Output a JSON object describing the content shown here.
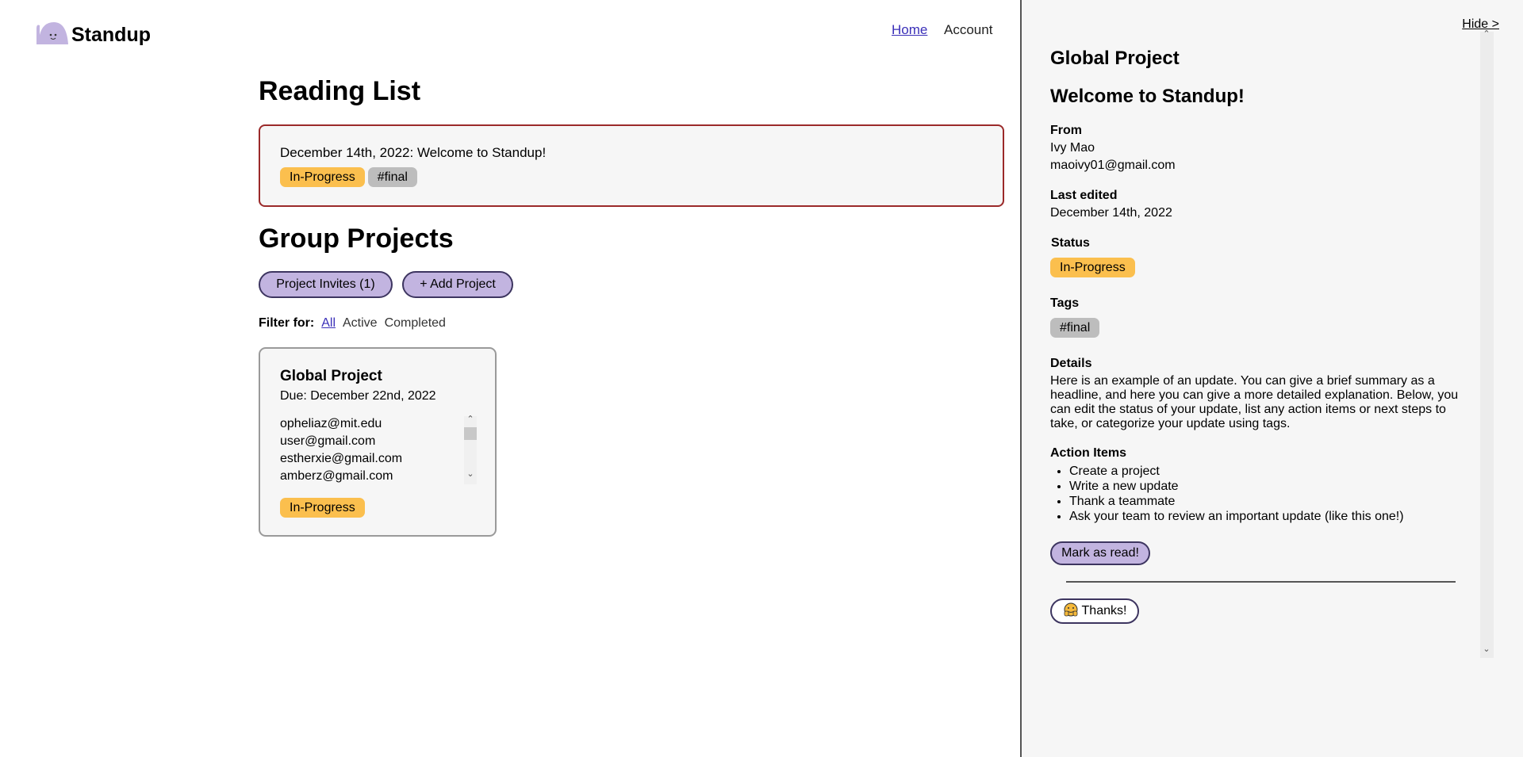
{
  "app": {
    "logo_text": "Standup"
  },
  "nav": {
    "home": "Home",
    "account": "Account"
  },
  "reading_list": {
    "heading": "Reading List",
    "items": [
      {
        "line": "December 14th, 2022: Welcome to Standup!",
        "status": "In-Progress",
        "tag": "#final"
      }
    ]
  },
  "group_projects": {
    "heading": "Group Projects",
    "invites_button": "Project Invites (1)",
    "add_button": "+ Add Project",
    "filter_label": "Filter for:",
    "filters": [
      "All",
      "Active",
      "Completed"
    ],
    "projects": [
      {
        "title": "Global Project",
        "due": "Due: December 22nd, 2022",
        "members": [
          "opheliaz@mit.edu",
          "user@gmail.com",
          "estherxie@gmail.com",
          "amberz@gmail.com"
        ],
        "status": "In-Progress"
      }
    ]
  },
  "sidebar": {
    "hide": "Hide >",
    "project": "Global Project",
    "title": "Welcome to Standup!",
    "from_label": "From",
    "from_name": "Ivy Mao",
    "from_email": "maoivy01@gmail.com",
    "edited_label": "Last edited",
    "edited_date": "December 14th, 2022",
    "status_label": "Status",
    "status": "In-Progress",
    "tags_label": "Tags",
    "tag": "#final",
    "details_label": "Details",
    "details": "Here is an example of an update. You can give a brief summary as a headline, and here you can give a more detailed explanation. Below, you can edit the status of your update, list any action items or next steps to take, or categorize your update using tags.",
    "actions_label": "Action Items",
    "actions": [
      "Create a project",
      "Write a new update",
      "Thank a teammate",
      "Ask your team to review an important update (like this one!)"
    ],
    "mark_read": "Mark as read!",
    "thanks": "Thanks!"
  },
  "colors": {
    "accent_purple": "#c2b4e0",
    "status_yellow": "#fbbf4e",
    "tag_gray": "#bdbdbd",
    "card_border_red": "#9b2a2a"
  }
}
